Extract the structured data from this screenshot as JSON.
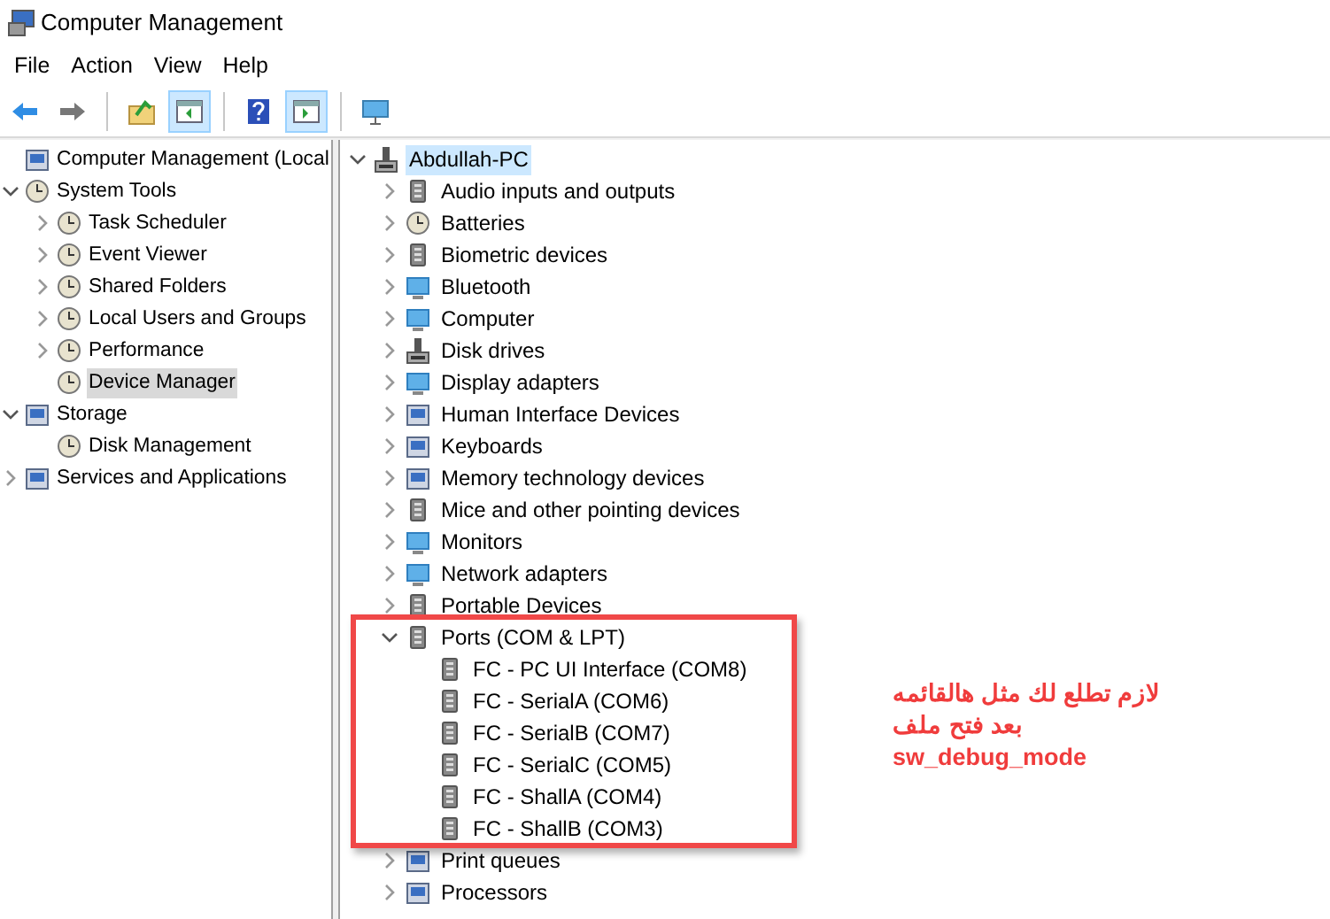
{
  "window": {
    "title": "Computer Management"
  },
  "menu": [
    "File",
    "Action",
    "View",
    "Help"
  ],
  "toolbar": [
    {
      "kind": "back",
      "pressed": false
    },
    {
      "kind": "forward",
      "pressed": false
    },
    {
      "kind": "sep"
    },
    {
      "kind": "up",
      "pressed": false
    },
    {
      "kind": "pane",
      "pressed": true
    },
    {
      "kind": "sep"
    },
    {
      "kind": "help",
      "pressed": false
    },
    {
      "kind": "pane2",
      "pressed": true
    },
    {
      "kind": "sep"
    },
    {
      "kind": "monitor",
      "pressed": false
    }
  ],
  "console_tree": [
    {
      "label": "Computer Management (Local",
      "selected": false,
      "children": [
        {
          "label": "System Tools",
          "expanded": true,
          "selected": false,
          "children": [
            {
              "label": "Task Scheduler",
              "expanded": false,
              "selected": false
            },
            {
              "label": "Event Viewer",
              "expanded": false,
              "selected": false
            },
            {
              "label": "Shared Folders",
              "expanded": false,
              "selected": false
            },
            {
              "label": "Local Users and Groups",
              "expanded": false,
              "selected": false
            },
            {
              "label": "Performance",
              "expanded": false,
              "selected": false
            },
            {
              "label": "Device Manager",
              "selected": true
            }
          ]
        },
        {
          "label": "Storage",
          "expanded": true,
          "selected": false,
          "children": [
            {
              "label": "Disk Management",
              "selected": false
            }
          ]
        },
        {
          "label": "Services and Applications",
          "expanded": false,
          "selected": false
        }
      ]
    }
  ],
  "device_tree": [
    {
      "label": "Abdullah-PC",
      "expanded": true,
      "selected": true,
      "children": [
        {
          "label": "Audio inputs and outputs",
          "expanded": false,
          "selected": false
        },
        {
          "label": "Batteries",
          "expanded": false,
          "selected": false
        },
        {
          "label": "Biometric devices",
          "expanded": false,
          "selected": false
        },
        {
          "label": "Bluetooth",
          "expanded": false,
          "selected": false
        },
        {
          "label": "Computer",
          "expanded": false,
          "selected": false
        },
        {
          "label": "Disk drives",
          "expanded": false,
          "selected": false
        },
        {
          "label": "Display adapters",
          "expanded": false,
          "selected": false
        },
        {
          "label": "Human Interface Devices",
          "expanded": false,
          "selected": false
        },
        {
          "label": "Keyboards",
          "expanded": false,
          "selected": false
        },
        {
          "label": "Memory technology devices",
          "expanded": false,
          "selected": false
        },
        {
          "label": "Mice and other pointing devices",
          "expanded": false,
          "selected": false
        },
        {
          "label": "Monitors",
          "expanded": false,
          "selected": false
        },
        {
          "label": "Network adapters",
          "expanded": false,
          "selected": false
        },
        {
          "label": "Portable Devices",
          "expanded": false,
          "selected": false
        },
        {
          "label": "Ports (COM & LPT)",
          "expanded": true,
          "selected": false,
          "children": [
            {
              "label": "FC - PC UI Interface (COM8)",
              "selected": false
            },
            {
              "label": "FC - SerialA (COM6)",
              "selected": false
            },
            {
              "label": "FC - SerialB (COM7)",
              "selected": false
            },
            {
              "label": "FC - SerialC (COM5)",
              "selected": false
            },
            {
              "label": "FC - ShallA (COM4)",
              "selected": false
            },
            {
              "label": "FC - ShallB (COM3)",
              "selected": false
            }
          ]
        },
        {
          "label": "Print queues",
          "expanded": false,
          "selected": false
        },
        {
          "label": "Processors",
          "expanded": false,
          "selected": false
        }
      ]
    }
  ],
  "annotation": {
    "lines": [
      "لازم تطلع لك مثل هالقائمه",
      "بعد فتح ملف",
      "sw_debug_mode"
    ]
  }
}
